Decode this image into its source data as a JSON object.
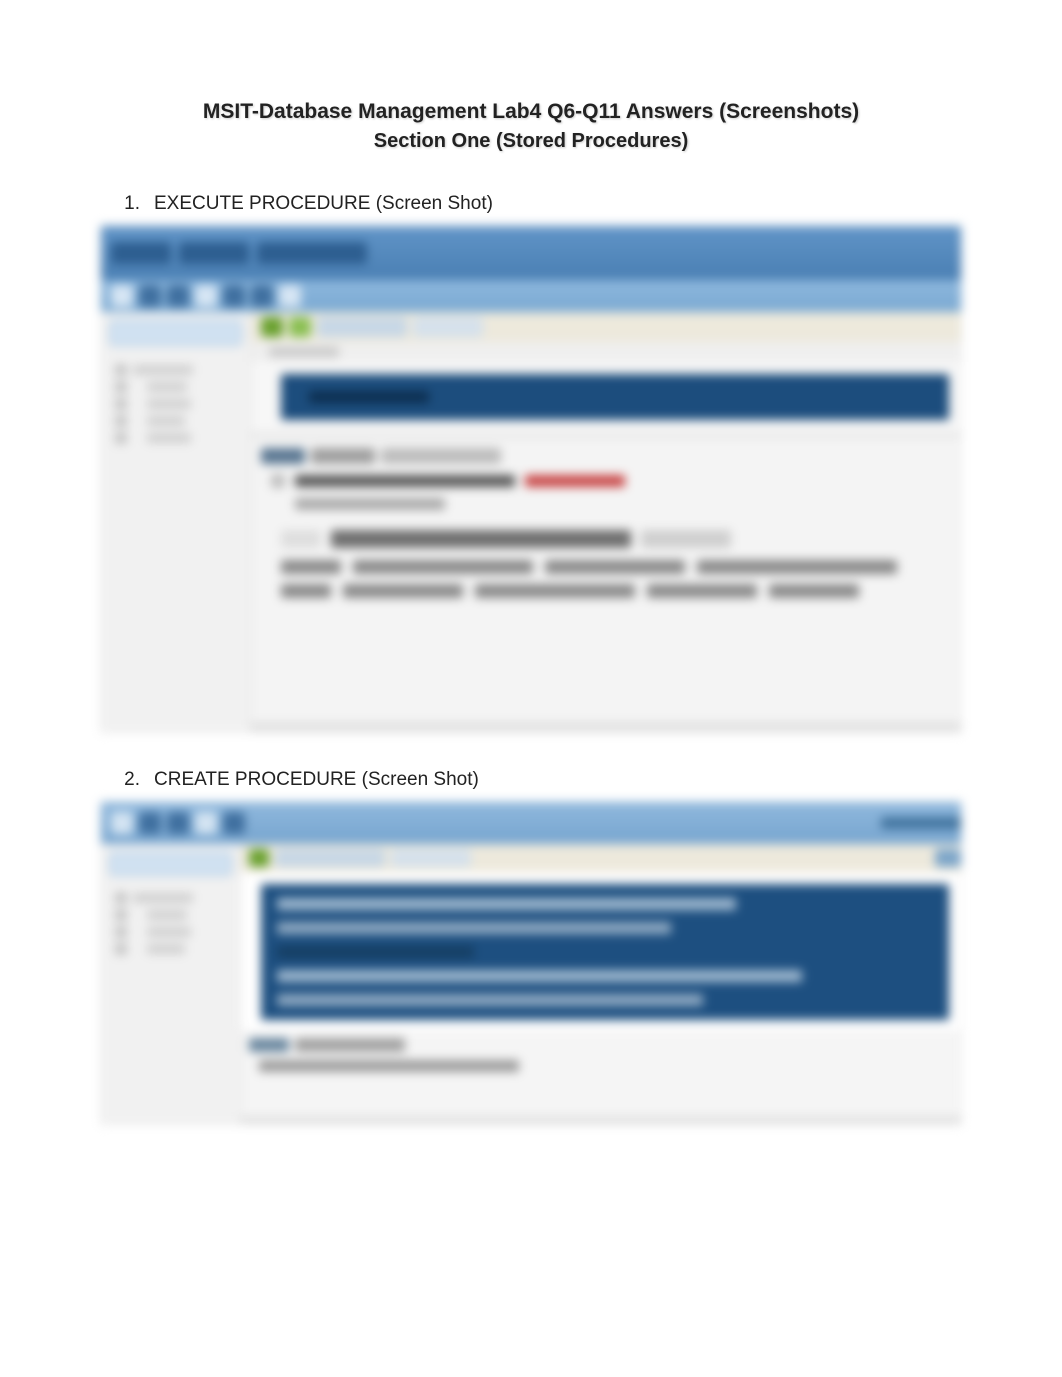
{
  "title": {
    "main": "MSIT-Database Management Lab4 Q6-Q11 Answers (Screenshots)",
    "sub": "Section One (Stored Procedures)"
  },
  "items": [
    {
      "number": "1.",
      "label": "EXECUTE PROCEDURE (Screen Shot)"
    },
    {
      "number": "2.",
      "label": "CREATE PROCEDURE (Screen Shot)"
    }
  ],
  "figures": {
    "fig1": {
      "alt": "Blurred screenshot of a SQL IDE showing an EXECUTE PROCEDURE statement in the query editor and a results/messages pane below.",
      "filename_bar": "(title bar text illegible)",
      "side_tree_root": "(tree label illegible)",
      "editor_highlight_line": "(SQL text illegible)",
      "results_caption": "(results caption illegible)",
      "results_message_primary": "(message text illegible)",
      "results_message_error": "(error-colored text illegible)"
    },
    "fig2": {
      "alt": "Blurred screenshot of a SQL IDE showing a CREATE PROCEDURE script in the query editor and a messages pane below.",
      "editor_lines_note": "(multi-line SQL text illegible)",
      "results_message": "(message text illegible)"
    }
  }
}
